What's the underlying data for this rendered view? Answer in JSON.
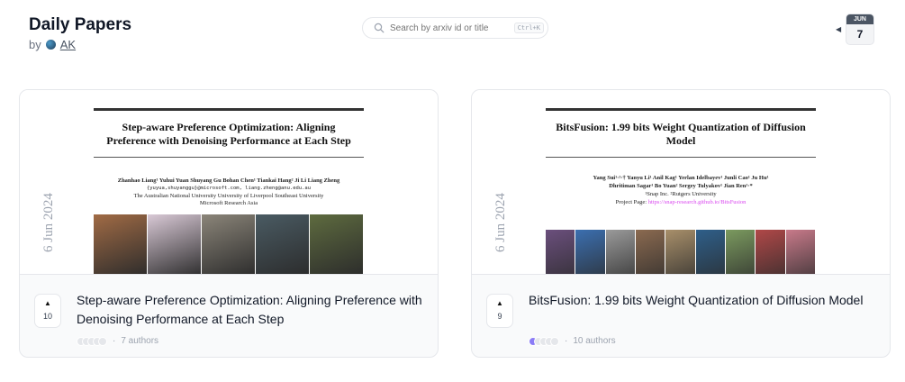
{
  "header": {
    "title": "Daily Papers",
    "by": "by",
    "author": "AK"
  },
  "search": {
    "placeholder": "Search by arxiv id or title",
    "shortcut": "Ctrl+K"
  },
  "date_nav": {
    "month": "JUN",
    "day": "7",
    "prev_icon": "triangle-left-icon"
  },
  "papers": [
    {
      "thumbnail": {
        "title_line1": "Step-aware Preference Optimization: Aligning",
        "title_line2": "Preference with Denoising Performance at Each Step",
        "authors_line": "Zhanhao Liang¹  Yuhui Yuan  Shuyang Gu  Bohan Chen¹  Tiankai Hang²  Ji Li  Liang Zheng",
        "emails_line": "{yuyua,shuyanggu}@microsoft.com, liang.zheng@anu.edu.au",
        "affil_line1": "The Australian National University   University of Liverpool   Southeast University",
        "affil_line2": "Microsoft Research Asia",
        "side_date": "6 Jun 2024",
        "tile_colors": [
          "#a16b45",
          "#d9c9d6",
          "#8b8579",
          "#4a5b63",
          "#5e6b3f"
        ]
      },
      "upvotes": "10",
      "title": "Step-aware Preference Optimization: Aligning Preference with Denoising Performance at Each Step",
      "authors_count": "7 authors"
    },
    {
      "thumbnail": {
        "title_line1": "BitsFusion: 1.99 bits Weight Quantization of Diffusion",
        "title_line2": "Model",
        "authors_line": "Yang Sui¹·²·†   Yanyu Li¹   Anil Kag¹   Yerlan Idelbayev¹   Junli Cao¹   Ju Hu¹",
        "authors_line2": "Dhritiman Sagar¹   Bo Yuan²   Sergey Tulyakov¹   Jian Ren¹·*",
        "affil_line1": "¹Snap Inc.     ²Rutgers University",
        "project_label": "Project Page: ",
        "project_link": "https://snap-research.github.io/BitsFusion",
        "side_date": "6 Jun 2024",
        "tile_colors": [
          "#6b4f7d",
          "#3b6fb0",
          "#9a9a9a",
          "#8b6a50",
          "#a88f6a",
          "#2e5f8a",
          "#7b9a5f",
          "#b04848",
          "#c87a8a"
        ]
      },
      "upvotes": "9",
      "title": "BitsFusion: 1.99 bits Weight Quantization of Diffusion Model",
      "authors_count": "10 authors"
    }
  ],
  "separator": "·"
}
